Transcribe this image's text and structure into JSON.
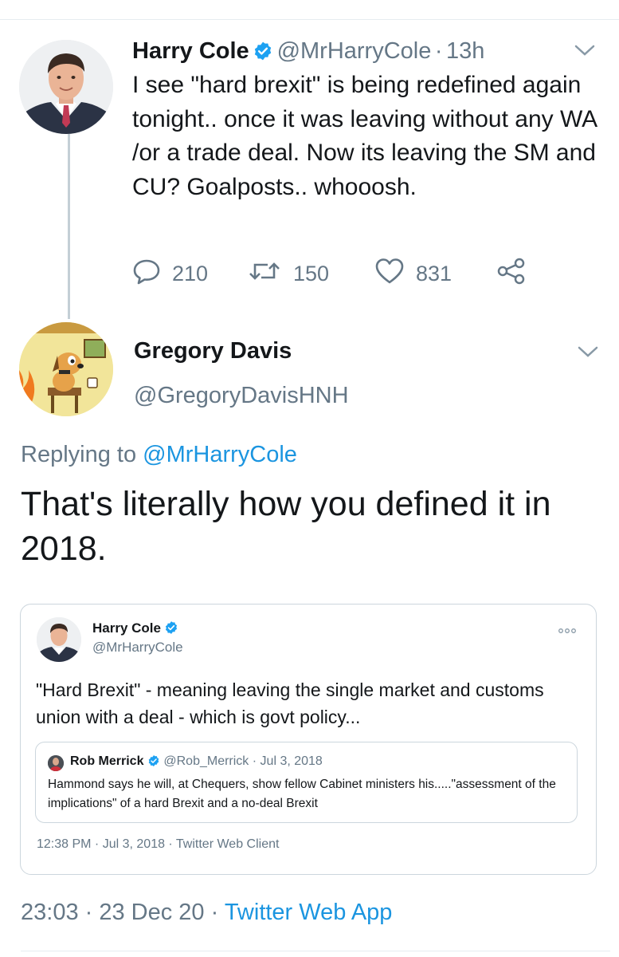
{
  "tweet": {
    "author_name": "Harry Cole",
    "author_handle": "@MrHarryCole",
    "time_sep": "·",
    "time": "13h",
    "text": "I see \"hard brexit\" is being redefined again tonight.. once it was leaving without any WA /or a trade deal. Now its leaving the SM and CU? Goalposts.. whooosh.",
    "replies": "210",
    "retweets": "150",
    "likes": "831"
  },
  "reply": {
    "author_name": "Gregory Davis",
    "author_handle": "@GregoryDavisHNH",
    "replying_prefix": "Replying to",
    "replying_to": "@MrHarryCole",
    "text": "That's literally how you defined it in 2018.",
    "timestamp": "23:03 · 23 Dec 20 ·",
    "source": "Twitter Web App"
  },
  "quoted": {
    "author_name": "Harry Cole",
    "author_handle": "@MrHarryCole",
    "text": "\"Hard Brexit\" - meaning leaving the single market and customs union with a deal - which is govt policy...",
    "meta": "12:38 PM · Jul 3, 2018 · Twitter Web Client",
    "inner": {
      "author_name": "Rob Merrick",
      "author_handle": "@Rob_Merrick",
      "date": "· Jul 3, 2018",
      "text": "Hammond says he will, at Chequers, show fellow Cabinet ministers his.....\"assessment of the implications\" of a hard Brexit and a no-deal Brexit"
    }
  },
  "colors": {
    "accent": "#1b95e0",
    "secondary_text": "#657786",
    "verified": "#1da1f2"
  },
  "icons": [
    "verified-badge-icon",
    "chevron-down-icon",
    "reply-icon",
    "retweet-icon",
    "like-icon",
    "share-icon",
    "more-options-icon"
  ]
}
